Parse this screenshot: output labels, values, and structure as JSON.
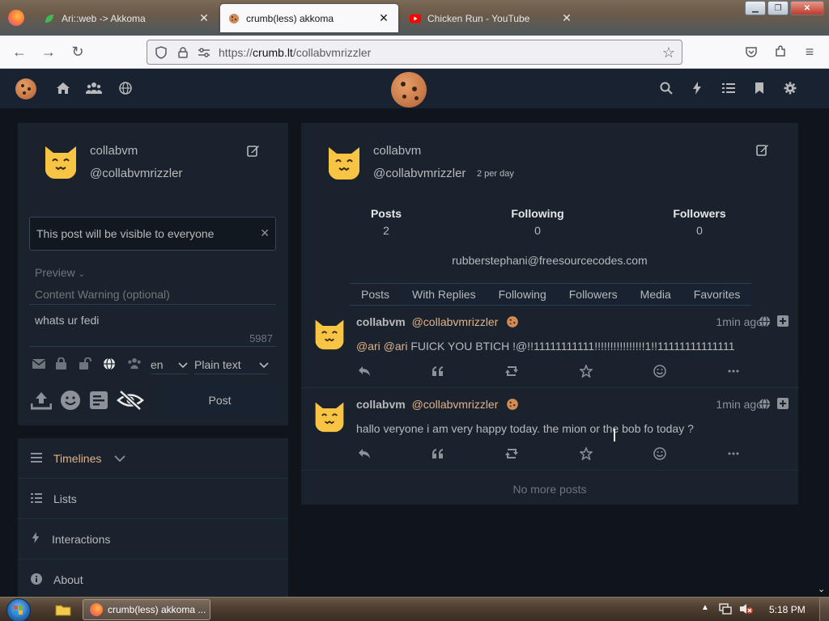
{
  "browser": {
    "tabs": [
      {
        "title": "Ari::web -> Akkoma",
        "icon": "leaf-icon",
        "active": false
      },
      {
        "title": "crumb(less) akkoma",
        "icon": "cookie-icon",
        "active": true
      },
      {
        "title": "Chicken Run - YouTube",
        "icon": "youtube-icon",
        "active": false
      }
    ],
    "url": {
      "protocol": "https://",
      "host": "crumb.lt",
      "path": "/collabvmrizzler"
    },
    "close_glyph": "✕"
  },
  "app_nav": {
    "left_icons": [
      "cookie-logo-icon",
      "home-icon",
      "users-icon",
      "globe-icon"
    ],
    "right_icons": [
      "search-icon",
      "bolt-icon",
      "list-icon",
      "bookmark-icon",
      "cog-icon"
    ]
  },
  "sidebar_user": {
    "display_name": "collabvm",
    "handle": "@collabvmrizzler"
  },
  "composer": {
    "visibility_notice": "This post will be visible to everyone",
    "preview_label": "Preview",
    "cw_placeholder": "Content Warning (optional)",
    "text_value": "whats ur fedi",
    "char_count": "5987",
    "language": "en",
    "format": "Plain text",
    "post_button": "Post"
  },
  "nav_menu": [
    {
      "label": "Timelines",
      "icon": "bars-icon",
      "expandable": true
    },
    {
      "label": "Lists",
      "icon": "list-icon",
      "expandable": false
    },
    {
      "label": "Interactions",
      "icon": "bolt-icon",
      "expandable": false
    },
    {
      "label": "About",
      "icon": "info-icon",
      "expandable": false
    }
  ],
  "profile": {
    "display_name": "collabvm",
    "handle": "@collabvmrizzler",
    "rate": "2 per day",
    "stats": [
      {
        "label": "Posts",
        "value": "2"
      },
      {
        "label": "Following",
        "value": "0"
      },
      {
        "label": "Followers",
        "value": "0"
      }
    ],
    "bio": "rubberstephani@freesourcecodes.com",
    "tabs": [
      "Posts",
      "With Replies",
      "Following",
      "Followers",
      "Media",
      "Favorites"
    ],
    "active_tab": "Posts"
  },
  "posts": [
    {
      "name": "collabvm",
      "handle": "@collabvmrizzler",
      "time": "1min ago",
      "mentions": "@ari @ari",
      "text": " FUICK YOU BTICH !@!!11111111111!!!!!!!!!!!!!!!!1!!11111111111111"
    },
    {
      "name": "collabvm",
      "handle": "@collabvmrizzler",
      "time": "1min ago",
      "mentions": "",
      "text": "hallo veryone i am very happy today. the mion or the bob fo today ?"
    }
  ],
  "no_more_posts": "No more posts",
  "taskbar": {
    "active_app": "crumb(less) akkoma ...",
    "clock": "5:18 PM"
  },
  "colors": {
    "app_nav_bg": "#182230",
    "panel_bg": "#1a222d",
    "page_bg": "#10151c",
    "accent": "#e2b188",
    "text": "#b9b9ba"
  }
}
